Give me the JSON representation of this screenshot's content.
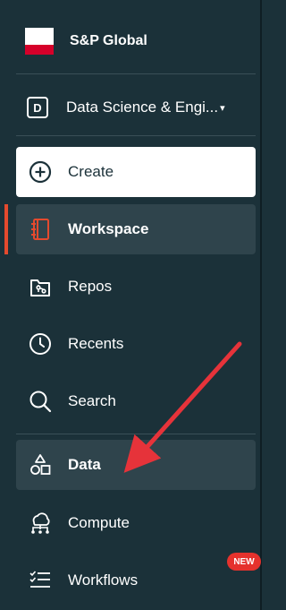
{
  "org": {
    "name": "S&P Global"
  },
  "workspace": {
    "initial": "D",
    "name": "Data Science & Engi...",
    "caret": "▾"
  },
  "create": {
    "label": "Create"
  },
  "nav": {
    "workspace": "Workspace",
    "repos": "Repos",
    "recents": "Recents",
    "search": "Search",
    "data": "Data",
    "compute": "Compute",
    "workflows": "Workflows"
  },
  "badges": {
    "new": "NEW"
  },
  "colors": {
    "sidebar_bg": "#1b3139",
    "active_bg": "#2f444c",
    "accent": "#e44a2e",
    "annotation_arrow": "#e6333a"
  },
  "icons": {
    "create": "plus-circle-icon",
    "workspace": "notebook-icon",
    "repos": "git-folder-icon",
    "recents": "clock-icon",
    "search": "magnifier-icon",
    "data": "shapes-icon",
    "compute": "cloud-nodes-icon",
    "workflows": "checklist-icon"
  }
}
